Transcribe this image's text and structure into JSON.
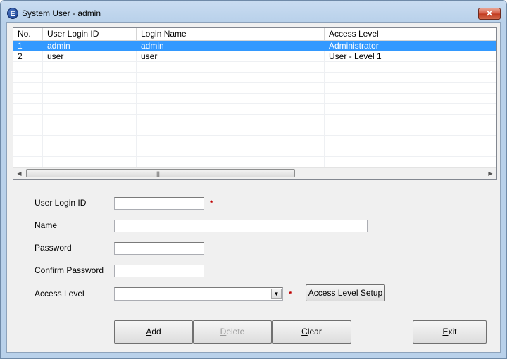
{
  "window": {
    "title": "System User - admin",
    "icon_letter": "E",
    "close_glyph": "✕"
  },
  "grid": {
    "columns": [
      "No.",
      "User Login ID",
      "Login Name",
      "Access Level"
    ],
    "rows": [
      {
        "no": "1",
        "login_id": "admin",
        "login_name": "admin",
        "access_level": "Administrator",
        "selected": true
      },
      {
        "no": "2",
        "login_id": "user",
        "login_name": "user",
        "access_level": "User - Level 1",
        "selected": false
      }
    ],
    "empty_rows": 10,
    "scroll_left": "◀",
    "scroll_right": "▶",
    "thumb_grip": "|||"
  },
  "form": {
    "user_login_id": {
      "label": "User Login ID",
      "value": "",
      "required": true
    },
    "name": {
      "label": "Name",
      "value": ""
    },
    "password": {
      "label": "Password",
      "value": ""
    },
    "confirm_password": {
      "label": "Confirm Password",
      "value": ""
    },
    "access_level": {
      "label": "Access Level",
      "value": "",
      "required": true
    },
    "required_mark": "*",
    "access_level_setup": "Access Level Setup",
    "combo_arrow": "▼"
  },
  "buttons": {
    "add": {
      "first": "A",
      "rest": "dd",
      "enabled": true
    },
    "delete": {
      "first": "D",
      "rest": "elete",
      "enabled": false
    },
    "clear": {
      "first": "C",
      "rest": "lear",
      "enabled": true
    },
    "exit": {
      "first": "E",
      "rest": "xit",
      "enabled": true
    }
  },
  "colors": {
    "selection": "#3399ff",
    "required": "#c00000",
    "client_bg": "#f0f0f0"
  }
}
